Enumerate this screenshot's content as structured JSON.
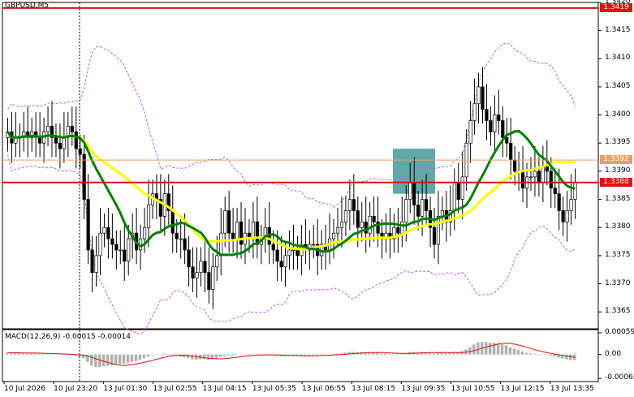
{
  "chart_data": {
    "type": "candlestick",
    "title": "GBPUSD,M5",
    "symbol": "GBPUSD",
    "timeframe": "M5",
    "price_axis": {
      "ticks": [
        "1.3420",
        "1.3415",
        "1.3410",
        "1.3405",
        "1.3400",
        "1.3395",
        "1.3390",
        "1.3385",
        "1.3380",
        "1.3375",
        "1.3370",
        "1.3365"
      ],
      "range": [
        1.3362,
        1.342
      ]
    },
    "time_axis": {
      "ticks": [
        "10 Jul 2026",
        "10 Jul 23:20",
        "13 Jul 01:30",
        "13 Jul 02:55",
        "13 Jul 04:15",
        "13 Jul 05:35",
        "13 Jul 06:55",
        "13 Jul 08:15",
        "13 Jul 09:35",
        "13 Jul 10:55",
        "13 Jul 12:15",
        "13 Jul 13:35"
      ]
    },
    "levels": [
      {
        "price": 1.3419,
        "label": "1.3419",
        "color": "#e01010"
      },
      {
        "price": 1.3392,
        "label": "1.3392",
        "color": "#e8a060"
      },
      {
        "price": 1.3388,
        "label": "1.3388",
        "color": "#e01010"
      }
    ],
    "closes": [
      1.3397,
      1.3395,
      1.3396,
      1.3396,
      1.3397,
      1.3396,
      1.3397,
      1.3396,
      1.3395,
      1.3397,
      1.3398,
      1.3396,
      1.3395,
      1.3394,
      1.3396,
      1.3398,
      1.3397,
      1.3394,
      1.3393,
      1.3385,
      1.3376,
      1.3372,
      1.3375,
      1.3379,
      1.338,
      1.3378,
      1.3377,
      1.3376,
      1.3376,
      1.3374,
      1.3378,
      1.3379,
      1.3376,
      1.3378,
      1.338,
      1.3384,
      1.3386,
      1.3385,
      1.3382,
      1.3386,
      1.3383,
      1.3379,
      1.3378,
      1.3378,
      1.3376,
      1.3373,
      1.3371,
      1.3372,
      1.3374,
      1.3372,
      1.3369,
      1.3373,
      1.3375,
      1.3379,
      1.3383,
      1.3379,
      1.3378,
      1.3381,
      1.3377,
      1.3379,
      1.3378,
      1.3381,
      1.3377,
      1.3378,
      1.338,
      1.3377,
      1.3376,
      1.3374,
      1.3373,
      1.3375,
      1.3376,
      1.3376,
      1.3375,
      1.3377,
      1.3376,
      1.3377,
      1.3377,
      1.3375,
      1.3377,
      1.3376,
      1.3378,
      1.3379,
      1.338,
      1.3381,
      1.3383,
      1.3385,
      1.3383,
      1.338,
      1.3381,
      1.3379,
      1.3382,
      1.3381,
      1.3379,
      1.3378,
      1.3379,
      1.3378,
      1.338,
      1.3379,
      1.3381,
      1.3385,
      1.3388,
      1.3384,
      1.3382,
      1.3385,
      1.3383,
      1.338,
      1.3377,
      1.3382,
      1.3383,
      1.3381,
      1.3383,
      1.3388,
      1.3385,
      1.3389,
      1.3395,
      1.3399,
      1.3402,
      1.3405,
      1.3401,
      1.3399,
      1.3397,
      1.34,
      1.3399,
      1.3396,
      1.3395,
      1.3392,
      1.339,
      1.339,
      1.3387,
      1.3389,
      1.3389,
      1.339,
      1.3388,
      1.3391,
      1.339,
      1.3387,
      1.3386,
      1.3383,
      1.3381,
      1.3383,
      1.3385,
      1.3388
    ],
    "moving_averages": [
      {
        "name": "yellow",
        "color": "#ffff00"
      },
      {
        "name": "green",
        "color": "#008000"
      }
    ],
    "bollinger_color": "#c060e0",
    "highlight_box": {
      "from": 1.3386,
      "to": 1.3394,
      "color": "#2e8b8b"
    },
    "macd": {
      "label": "MACD(12,26,9) -0.00015 -0.00014",
      "ticks": [
        "0.00059",
        "0.00",
        "-0.00065"
      ],
      "range": [
        -0.00065,
        0.00059
      ],
      "histogram": [
        5e-05,
        5e-05,
        4e-05,
        4e-05,
        3e-05,
        3e-05,
        4e-05,
        3e-05,
        2e-05,
        2e-05,
        2e-05,
        1e-05,
        0.0,
        -1e-05,
        -1e-05,
        -1e-05,
        -2e-05,
        -3e-05,
        -5e-05,
        -0.0001,
        -0.0002,
        -0.0003,
        -0.00034,
        -0.00034,
        -0.00032,
        -0.00031,
        -0.0003,
        -0.00028,
        -0.00026,
        -0.00025,
        -0.00022,
        -0.0002,
        -0.00018,
        -0.00014,
        -0.0001,
        -6e-05,
        -2e-05,
        0.0,
        0.0,
        2e-05,
        1e-05,
        -2e-05,
        -4e-05,
        -6e-05,
        -8e-05,
        -0.0001,
        -0.00013,
        -0.00014,
        -0.00013,
        -0.00013,
        -0.00014,
        -0.00012,
        -0.0001,
        -7e-05,
        -4e-05,
        -3e-05,
        -3e-05,
        -1e-05,
        -2e-05,
        -1e-05,
        -1e-05,
        0.0,
        -1e-05,
        -1e-05,
        0.0,
        -1e-05,
        -2e-05,
        -4e-05,
        -5e-05,
        -5e-05,
        -4e-05,
        -4e-05,
        -4e-05,
        -3e-05,
        -3e-05,
        -2e-05,
        -2e-05,
        -2e-05,
        -1e-05,
        -1e-05,
        0.0,
        1e-05,
        2e-05,
        3e-05,
        5e-05,
        7e-05,
        7e-05,
        6e-05,
        6e-05,
        5e-05,
        5e-05,
        5e-05,
        4e-05,
        3e-05,
        3e-05,
        2e-05,
        2e-05,
        2e-05,
        2e-05,
        4e-05,
        7e-05,
        7e-05,
        6e-05,
        7e-05,
        6e-05,
        5e-05,
        3e-05,
        4e-05,
        5e-05,
        4e-05,
        5e-05,
        7e-05,
        7e-05,
        9e-05,
        0.00014,
        0.0002,
        0.00027,
        0.00033,
        0.00034,
        0.00034,
        0.00032,
        0.00032,
        0.00031,
        0.00028,
        0.00025,
        0.0002,
        0.00016,
        0.00012,
        8e-05,
        5e-05,
        3e-05,
        2e-05,
        0.0,
        0.0,
        -1e-05,
        -3e-05,
        -5e-05,
        -8e-05,
        -0.00011,
        -0.00013,
        -0.00015,
        -0.00015
      ]
    }
  }
}
